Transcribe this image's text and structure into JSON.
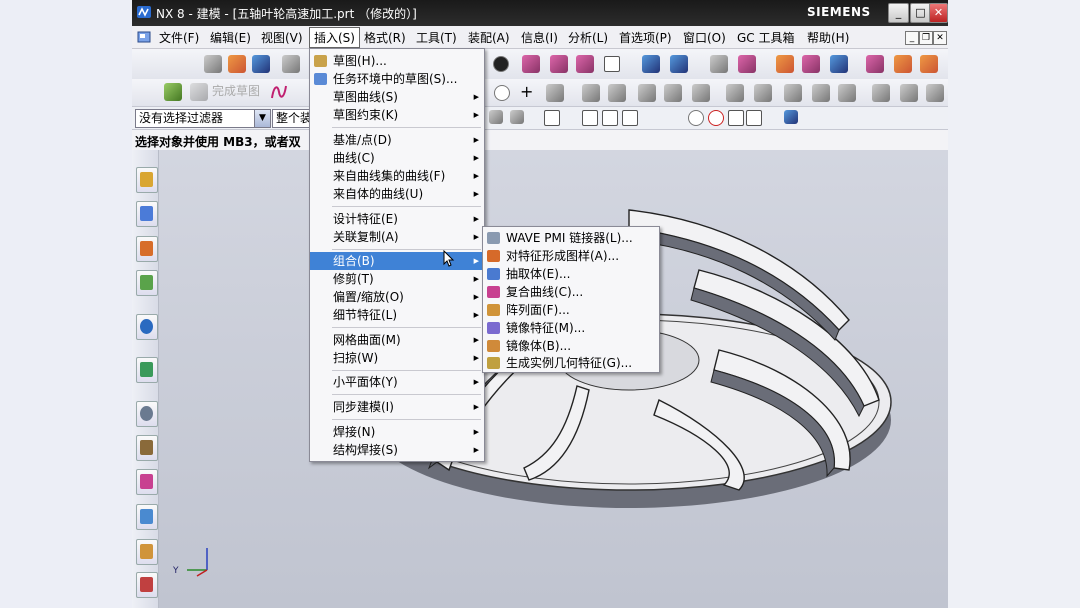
{
  "window": {
    "title": "NX 8 - 建模 - [五轴叶轮高速加工.prt （修改的）]",
    "brand": "SIEMENS",
    "controls": [
      "_",
      "□",
      "✕"
    ]
  },
  "menubar": {
    "items": [
      "文件(F)",
      "编辑(E)",
      "视图(V)",
      "插入(S)",
      "格式(R)",
      "工具(T)",
      "装配(A)",
      "信息(I)",
      "分析(L)",
      "首选项(P)",
      "窗口(O)",
      "GC 工具箱",
      "帮助(H)"
    ],
    "active": "插入(S)"
  },
  "toolbar2": {
    "finish_sketch": "完成草图"
  },
  "filters": {
    "selection_filter": "没有选择过滤器",
    "scope": "整个装"
  },
  "cue_line": "选择对象并使用 MB3，或者双",
  "insert_menu": {
    "groups": [
      [
        "草图(H)...",
        "任务环境中的草图(S)...",
        "草图曲线(S)",
        "草图约束(K)"
      ],
      [
        "基准/点(D)",
        "曲线(C)",
        "来自曲线集的曲线(F)",
        "来自体的曲线(U)"
      ],
      [
        "设计特征(E)",
        "关联复制(A)"
      ],
      [
        "组合(B)",
        "修剪(T)",
        "偏置/缩放(O)",
        "细节特征(L)"
      ],
      [
        "网格曲面(M)",
        "扫掠(W)"
      ],
      [
        "小平面体(Y)"
      ],
      [
        "同步建模(I)"
      ],
      [
        "焊接(N)",
        "结构焊接(S)"
      ]
    ],
    "highlighted": "组合(B)"
  },
  "combine_submenu": {
    "items": [
      "WAVE PMI 链接器(L)...",
      "对特征形成图样(A)...",
      "抽取体(E)...",
      "复合曲线(C)...",
      "阵列面(F)...",
      "镜像特征(M)...",
      "镜像体(B)...",
      "生成实例几何特征(G)..."
    ]
  },
  "triad": {
    "y_label": "Y"
  },
  "colors": {
    "titlebar": "#1a1a1a",
    "highlight": "#3f82d6",
    "viewport": "#c8cbd6",
    "impeller_light": "#ececef",
    "impeller_dark": "#6a6d78"
  }
}
